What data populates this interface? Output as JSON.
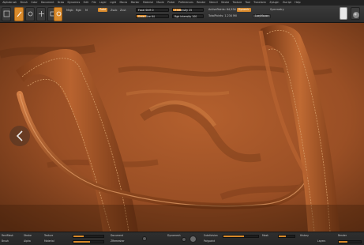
{
  "menu": [
    "Alphabrush",
    "Brush",
    "Color",
    "Document",
    "Draw",
    "Dynamics",
    "Edit",
    "File",
    "Layer",
    "Light",
    "Macro",
    "Marker",
    "Material",
    "Movie",
    "Picker",
    "Preferences",
    "Render",
    "Stencil",
    "Stroke",
    "Texture",
    "Tool",
    "Transform",
    "Zplugin",
    "Zscript",
    "Help"
  ],
  "toolbar": {
    "edit_label": "Edit",
    "draw_label": "Draw",
    "move_label": "Move",
    "scale_label": "Scale",
    "rotate_label": "Rotate",
    "mrgb_label": "Mrgb",
    "rgb_label": "Rgb",
    "m_label": "M",
    "zadd_label": "Zadd",
    "zsub_label": "Zsub",
    "zcut_label": "Zcut",
    "focal_shift_label": "Focal Shift 0",
    "draw_size_label": "Draw Size 64",
    "z_intensity_label": "Z Intensity 25",
    "rgb_intensity_label": "Rgb Intensity 100",
    "active_points_label": "ActivePoints: 64,934",
    "total_points_label": "TotalPoints: 1.234 Mil",
    "dynamic_label": "Dynamic",
    "lazymouse_label": "LazyMouse",
    "symmetry_label": "Symmetry",
    "active_color": "#d98a2b"
  },
  "viewport": {
    "subject": "leather-bag-render",
    "leather_color": "#9a5128",
    "stitch_color": "#d39a66"
  },
  "bottombar": {
    "label_1": "RectMask",
    "label_2": "Brush",
    "label_3": "Stroke",
    "label_4": "Alpha",
    "label_5": "Texture",
    "label_6": "Material",
    "label_7": "Document",
    "label_8": "ZRemesher",
    "label_9": "Dynamesh",
    "label_10": "Subdivision",
    "label_11": "Polypaint",
    "label_12": "Mask",
    "label_13": "History",
    "label_14": "Layers",
    "label_15": "Render"
  }
}
